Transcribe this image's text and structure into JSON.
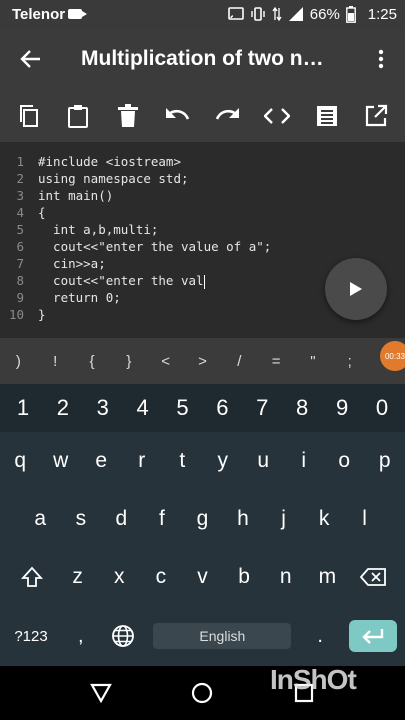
{
  "status_bar": {
    "carrier": "Telenor",
    "battery": "66%",
    "time": "1:25"
  },
  "app_bar": {
    "title": "Multiplication of two n…",
    "back_icon": "arrow-left-icon",
    "menu_icon": "more-vert-icon"
  },
  "toolbar": {
    "tools": [
      "copy-icon",
      "paste-icon",
      "delete-icon",
      "undo-icon",
      "redo-icon",
      "code-icon",
      "document-icon",
      "open-external-icon"
    ]
  },
  "editor": {
    "lines": [
      {
        "num": "1",
        "text": "#include <iostream>"
      },
      {
        "num": "2",
        "text": "using namespace std;"
      },
      {
        "num": "3",
        "text": "int main()"
      },
      {
        "num": "4",
        "text": "{"
      },
      {
        "num": "5",
        "text": "  int a,b,multi;"
      },
      {
        "num": "6",
        "text": "  cout<<\"enter the value of a\";"
      },
      {
        "num": "7",
        "text": "  cin>>a;"
      },
      {
        "num": "8",
        "text": "  cout<<\"enter the val"
      },
      {
        "num": "9",
        "text": "  return 0;"
      },
      {
        "num": "10",
        "text": "}"
      }
    ]
  },
  "run_button": {
    "icon": "play-icon"
  },
  "symbol_bar": {
    "symbols": [
      ")",
      "!",
      "{",
      "}",
      "<",
      ">",
      "/",
      "=",
      "\"",
      ";",
      "+"
    ],
    "recording_badge": "00:33"
  },
  "keyboard": {
    "numbers": [
      "1",
      "2",
      "3",
      "4",
      "5",
      "6",
      "7",
      "8",
      "9",
      "0"
    ],
    "row1": [
      "q",
      "w",
      "e",
      "r",
      "t",
      "y",
      "u",
      "i",
      "o",
      "p"
    ],
    "row2": [
      "a",
      "s",
      "d",
      "f",
      "g",
      "h",
      "j",
      "k",
      "l"
    ],
    "row3": [
      "z",
      "x",
      "c",
      "v",
      "b",
      "n",
      "m"
    ],
    "symbols_key": "?123",
    "comma": ",",
    "space_label": "English",
    "period": ".",
    "accent_color": "#7ec9c3"
  },
  "nav_bar": {
    "buttons": [
      "back-triangle-icon",
      "home-circle-icon",
      "recents-square-icon"
    ]
  },
  "watermark": "InShOt"
}
